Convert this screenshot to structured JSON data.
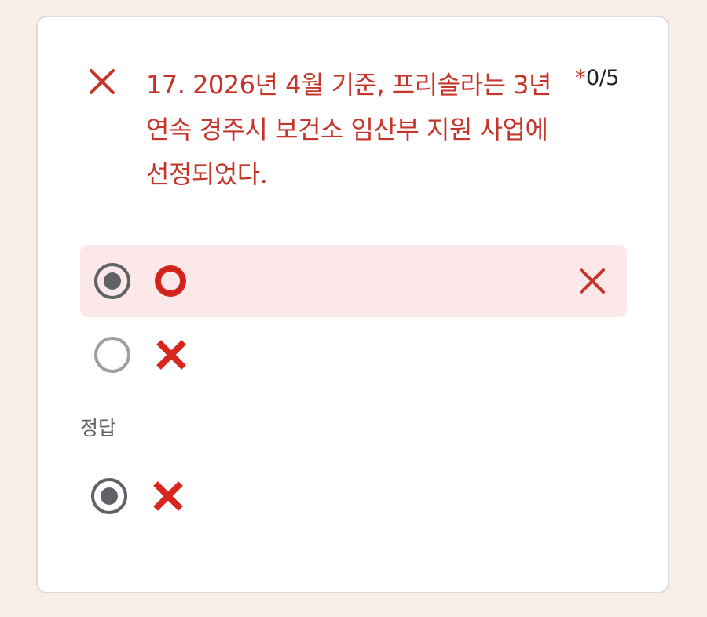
{
  "question": {
    "text": "17. 2026년 4월 기준, 프리솔라는 3년 연속 경주시 보건소 임산부 지원 사업에 선정되었다.",
    "required_mark": "*",
    "score": "0/5",
    "status": "incorrect",
    "status_icon": "x-icon",
    "colors": {
      "incorrect": "#c5352a",
      "selected_bg": "#fce8e8",
      "card_bg": "#ffffff",
      "page_bg": "#faefe6"
    }
  },
  "options": [
    {
      "icon": "heavy-large-circle-icon",
      "selected": true,
      "result": "incorrect"
    },
    {
      "icon": "cross-mark-icon",
      "selected": false
    }
  ],
  "correct_answer": {
    "label": "정답",
    "option": {
      "icon": "cross-mark-icon",
      "selected": true
    }
  }
}
